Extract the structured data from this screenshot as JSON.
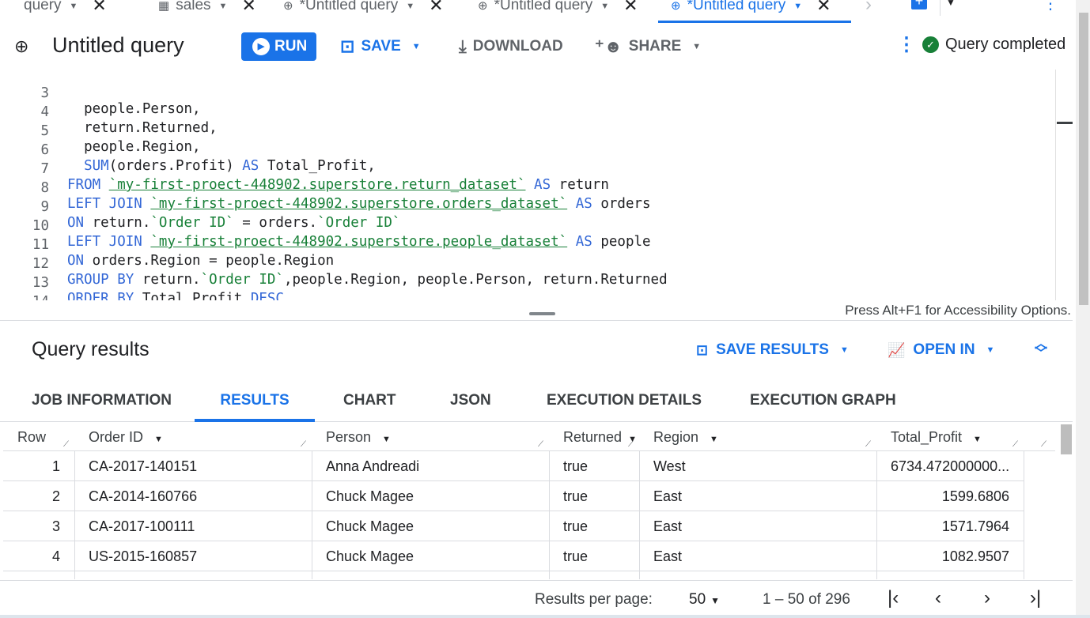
{
  "tabs": [
    {
      "label": "query",
      "icon": "query-icon",
      "active": false
    },
    {
      "label": "sales",
      "icon": "table-icon",
      "active": false
    },
    {
      "label": "*Untitled query",
      "icon": "query-icon",
      "active": false
    },
    {
      "label": "*Untitled query",
      "icon": "query-icon",
      "active": false
    },
    {
      "label": "*Untitled query",
      "icon": "query-icon",
      "active": true
    }
  ],
  "toolbar": {
    "title": "Untitled query",
    "run_label": "RUN",
    "save_label": "SAVE",
    "download_label": "DOWNLOAD",
    "share_label": "SHARE",
    "status_text": "Query completed"
  },
  "editor": {
    "lines": [
      {
        "n": "3",
        "code": "  people.Person,"
      },
      {
        "n": "4",
        "code": "  return.Returned,"
      },
      {
        "n": "5",
        "code": "  people.Region,"
      },
      {
        "n": "6",
        "code": "  SUM(orders.Profit) AS Total_Profit,"
      },
      {
        "n": "7",
        "code": "FROM `my-first-proect-448902.superstore.return_dataset` AS return"
      },
      {
        "n": "8",
        "code": "LEFT JOIN `my-first-proect-448902.superstore.orders_dataset` AS orders"
      },
      {
        "n": "9",
        "code": "ON return.`Order ID` = orders.`Order ID`"
      },
      {
        "n": "10",
        "code": "LEFT JOIN `my-first-proect-448902.superstore.people_dataset` AS people"
      },
      {
        "n": "11",
        "code": "ON orders.Region = people.Region"
      },
      {
        "n": "12",
        "code": "GROUP BY return.`Order ID`,people.Region, people.Person, return.Returned"
      },
      {
        "n": "13",
        "code": "ORDER BY Total_Profit DESC"
      },
      {
        "n": "14",
        "code": ""
      }
    ],
    "accessibility_hint": "Press Alt+F1 for Accessibility Options."
  },
  "results": {
    "title": "Query results",
    "save_results_label": "SAVE RESULTS",
    "open_in_label": "OPEN IN",
    "tabs": [
      "JOB INFORMATION",
      "RESULTS",
      "CHART",
      "JSON",
      "EXECUTION DETAILS",
      "EXECUTION GRAPH"
    ],
    "active_tab": "RESULTS",
    "columns": [
      "Row",
      "Order ID",
      "Person",
      "Returned",
      "Region",
      "Total_Profit"
    ],
    "rows": [
      [
        "1",
        "CA-2017-140151",
        "Anna Andreadi",
        "true",
        "West",
        "6734.472000000..."
      ],
      [
        "2",
        "CA-2014-160766",
        "Chuck Magee",
        "true",
        "East",
        "1599.6806"
      ],
      [
        "3",
        "CA-2017-100111",
        "Chuck Magee",
        "true",
        "East",
        "1571.7964"
      ],
      [
        "4",
        "US-2015-160857",
        "Chuck Magee",
        "true",
        "East",
        "1082.9507"
      ]
    ]
  },
  "pagination": {
    "label": "Results per page:",
    "page_size": "50",
    "range": "1 – 50 of 296"
  },
  "colors": {
    "accent": "#1a73e8",
    "success": "#188038",
    "keyword": "#3367d6"
  }
}
